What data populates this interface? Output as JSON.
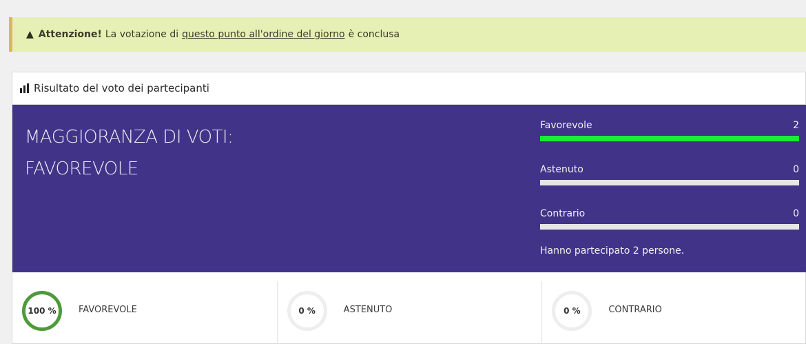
{
  "alert": {
    "icon": "warning-icon",
    "strong": "Attenzione!",
    "text_before": "La votazione di",
    "link_text": "questo punto all'ordine del giorno",
    "text_after": "è conclusa"
  },
  "panel": {
    "heading_icon": "bar-chart-icon",
    "heading": "Risultato del voto dei partecipanti"
  },
  "result": {
    "majority_line1": "MAGGIORANZA DI VOTI:",
    "majority_line2": "FAVOREVOLE",
    "votes": [
      {
        "label": "Favorevole",
        "count": "2",
        "fraction": 1
      },
      {
        "label": "Astenuto",
        "count": "0",
        "fraction": 0
      },
      {
        "label": "Contrario",
        "count": "0",
        "fraction": 0
      }
    ],
    "participants": "Hanno partecipato 2 persone.",
    "background_color": "#413488",
    "bar_color": "#18ee35"
  },
  "summary": [
    {
      "percent": "100 %",
      "label": "FAVOREVOLE",
      "ring_color": "#4e9a3a"
    },
    {
      "percent": "0 %",
      "label": "ASTENUTO",
      "ring_color": "#eeeeee"
    },
    {
      "percent": "0 %",
      "label": "CONTRARIO",
      "ring_color": "#eeeeee"
    }
  ]
}
